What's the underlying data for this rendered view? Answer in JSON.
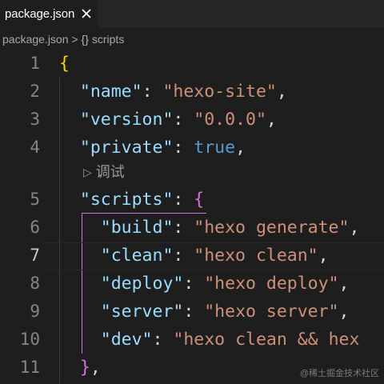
{
  "tab": {
    "label": "package.json",
    "close_icon": "close-icon"
  },
  "breadcrumb": {
    "file": "package.json",
    "separator": ">",
    "symbol_icon": "{}",
    "symbol": "scripts"
  },
  "codelens": {
    "icon": "play-triangle-icon",
    "label": "调试"
  },
  "lines": [
    {
      "num": "1",
      "tokens": [
        {
          "t": "{",
          "c": "brace"
        }
      ]
    },
    {
      "num": "2",
      "tokens": [
        {
          "t": "  "
        },
        {
          "t": "\"name\"",
          "c": "k"
        },
        {
          "t": ": "
        },
        {
          "t": "\"hexo-site\"",
          "c": "s"
        },
        {
          "t": ","
        }
      ]
    },
    {
      "num": "3",
      "tokens": [
        {
          "t": "  "
        },
        {
          "t": "\"version\"",
          "c": "k"
        },
        {
          "t": ": "
        },
        {
          "t": "\"0.0.0\"",
          "c": "s"
        },
        {
          "t": ","
        }
      ]
    },
    {
      "num": "4",
      "tokens": [
        {
          "t": "  "
        },
        {
          "t": "\"private\"",
          "c": "k"
        },
        {
          "t": ": "
        },
        {
          "t": "true",
          "c": "b"
        },
        {
          "t": ","
        }
      ]
    },
    {
      "num": "5",
      "tokens": [
        {
          "t": "  "
        },
        {
          "t": "\"scripts\"",
          "c": "k"
        },
        {
          "t": ": "
        },
        {
          "t": "{",
          "c": "brace2"
        }
      ]
    },
    {
      "num": "6",
      "tokens": [
        {
          "t": "    "
        },
        {
          "t": "\"build\"",
          "c": "k"
        },
        {
          "t": ": "
        },
        {
          "t": "\"hexo generate\"",
          "c": "s"
        },
        {
          "t": ","
        }
      ]
    },
    {
      "num": "7",
      "tokens": [
        {
          "t": "    "
        },
        {
          "t": "\"clean\"",
          "c": "k"
        },
        {
          "t": ": "
        },
        {
          "t": "\"hexo clean\"",
          "c": "s"
        },
        {
          "t": ","
        }
      ]
    },
    {
      "num": "8",
      "tokens": [
        {
          "t": "    "
        },
        {
          "t": "\"deploy\"",
          "c": "k"
        },
        {
          "t": ": "
        },
        {
          "t": "\"hexo deploy\"",
          "c": "s"
        },
        {
          "t": ","
        }
      ]
    },
    {
      "num": "9",
      "tokens": [
        {
          "t": "    "
        },
        {
          "t": "\"server\"",
          "c": "k"
        },
        {
          "t": ": "
        },
        {
          "t": "\"hexo server\"",
          "c": "s"
        },
        {
          "t": ","
        }
      ]
    },
    {
      "num": "10",
      "tokens": [
        {
          "t": "    "
        },
        {
          "t": "\"dev\"",
          "c": "k"
        },
        {
          "t": ": "
        },
        {
          "t": "\"hexo clean && hex",
          "c": "s"
        }
      ]
    },
    {
      "num": "11",
      "tokens": [
        {
          "t": "  "
        },
        {
          "t": "}",
          "c": "brace2"
        },
        {
          "t": ","
        }
      ]
    }
  ],
  "active_line": "7",
  "watermark": "@稀土掘金技术社区",
  "colors": {
    "background": "#1e1e1e",
    "key": "#9cdcfe",
    "string": "#ce9178",
    "boolean": "#569cd6",
    "bracket_outer": "#ffd700",
    "bracket_inner": "#da70d6",
    "active_guide": "#c678dd"
  }
}
